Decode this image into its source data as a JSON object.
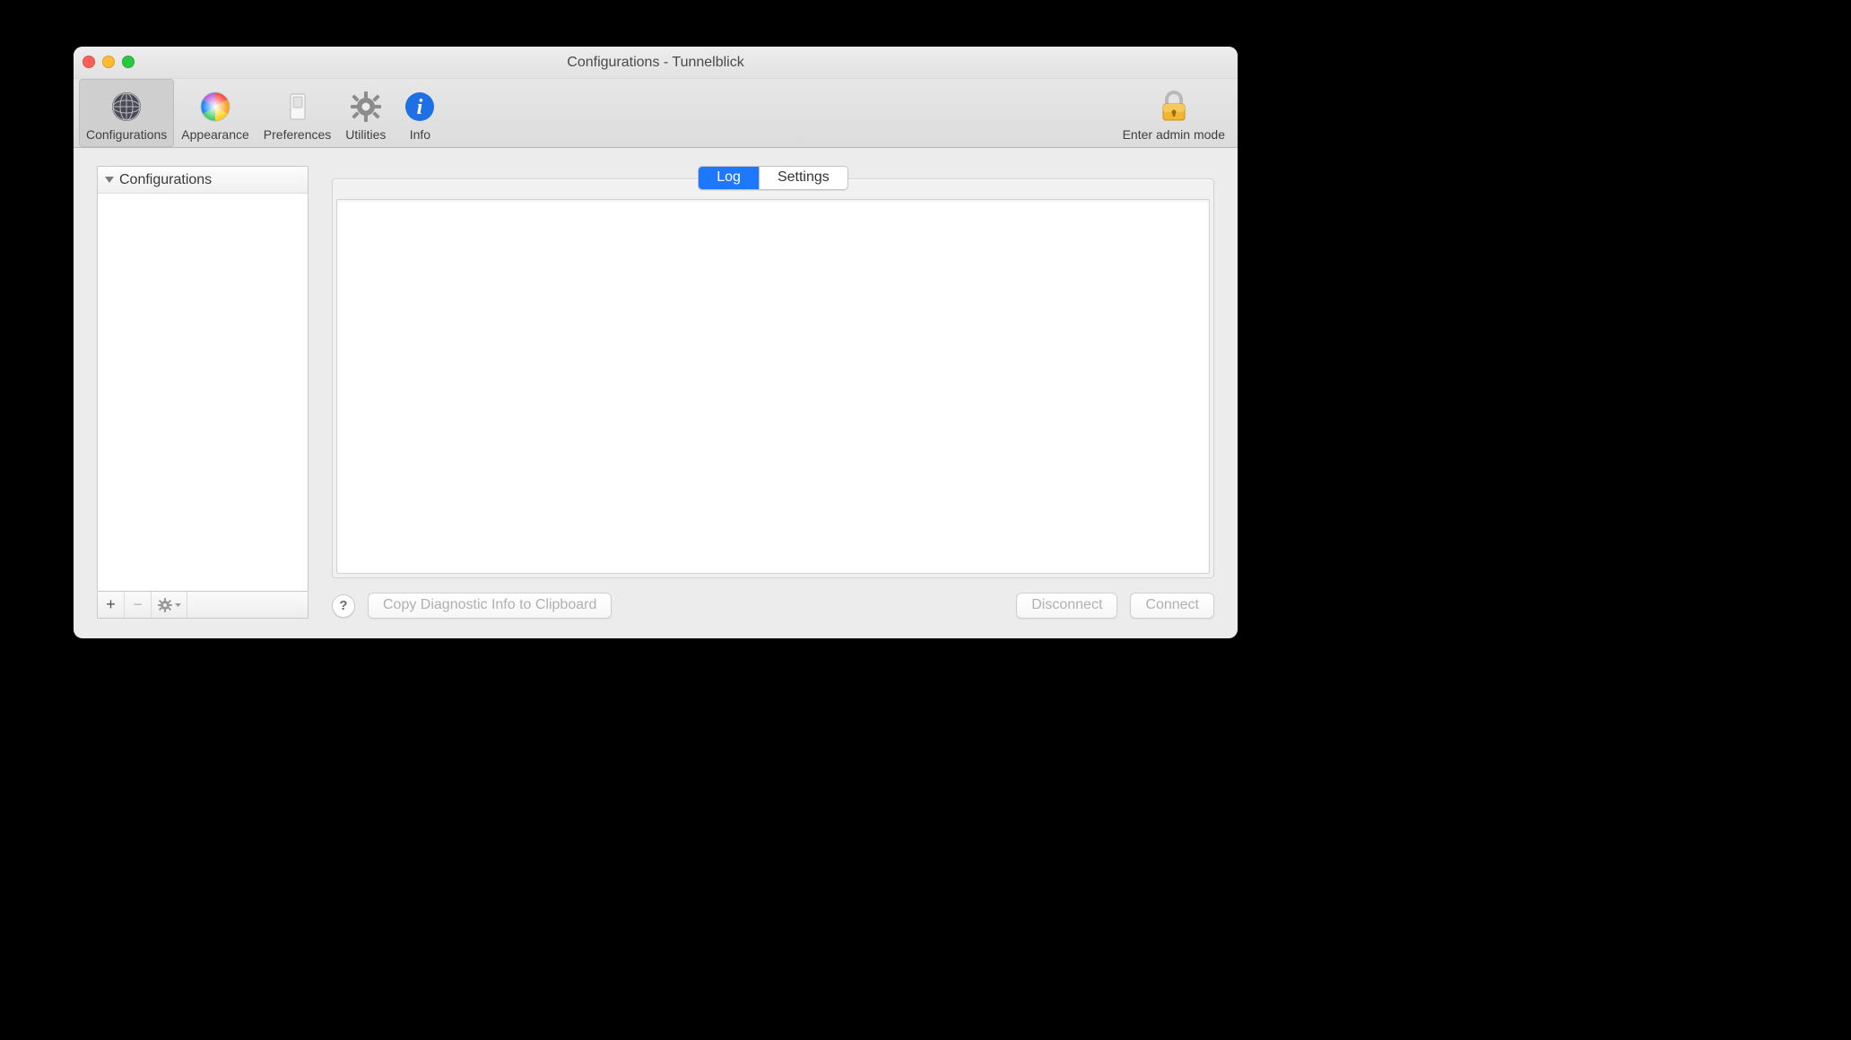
{
  "window": {
    "title": "Configurations - Tunnelblick"
  },
  "toolbar": {
    "items": [
      {
        "label": "Configurations",
        "icon": "network-globe-icon",
        "selected": true
      },
      {
        "label": "Appearance",
        "icon": "color-wheel-icon",
        "selected": false
      },
      {
        "label": "Preferences",
        "icon": "switch-icon",
        "selected": false
      },
      {
        "label": "Utilities",
        "icon": "gear-icon",
        "selected": false
      },
      {
        "label": "Info",
        "icon": "info-icon",
        "selected": false
      }
    ],
    "admin_label": "Enter admin mode"
  },
  "sidebar": {
    "header": "Configurations",
    "items": [],
    "footer": {
      "add_tooltip": "+",
      "remove_tooltip": "−",
      "actions_tooltip": "⚙"
    }
  },
  "main": {
    "segments": [
      {
        "label": "Log",
        "active": true
      },
      {
        "label": "Settings",
        "active": false
      }
    ],
    "log_text": ""
  },
  "buttons": {
    "help": "?",
    "copy_diag": "Copy Diagnostic Info to Clipboard",
    "disconnect": "Disconnect",
    "connect": "Connect"
  }
}
